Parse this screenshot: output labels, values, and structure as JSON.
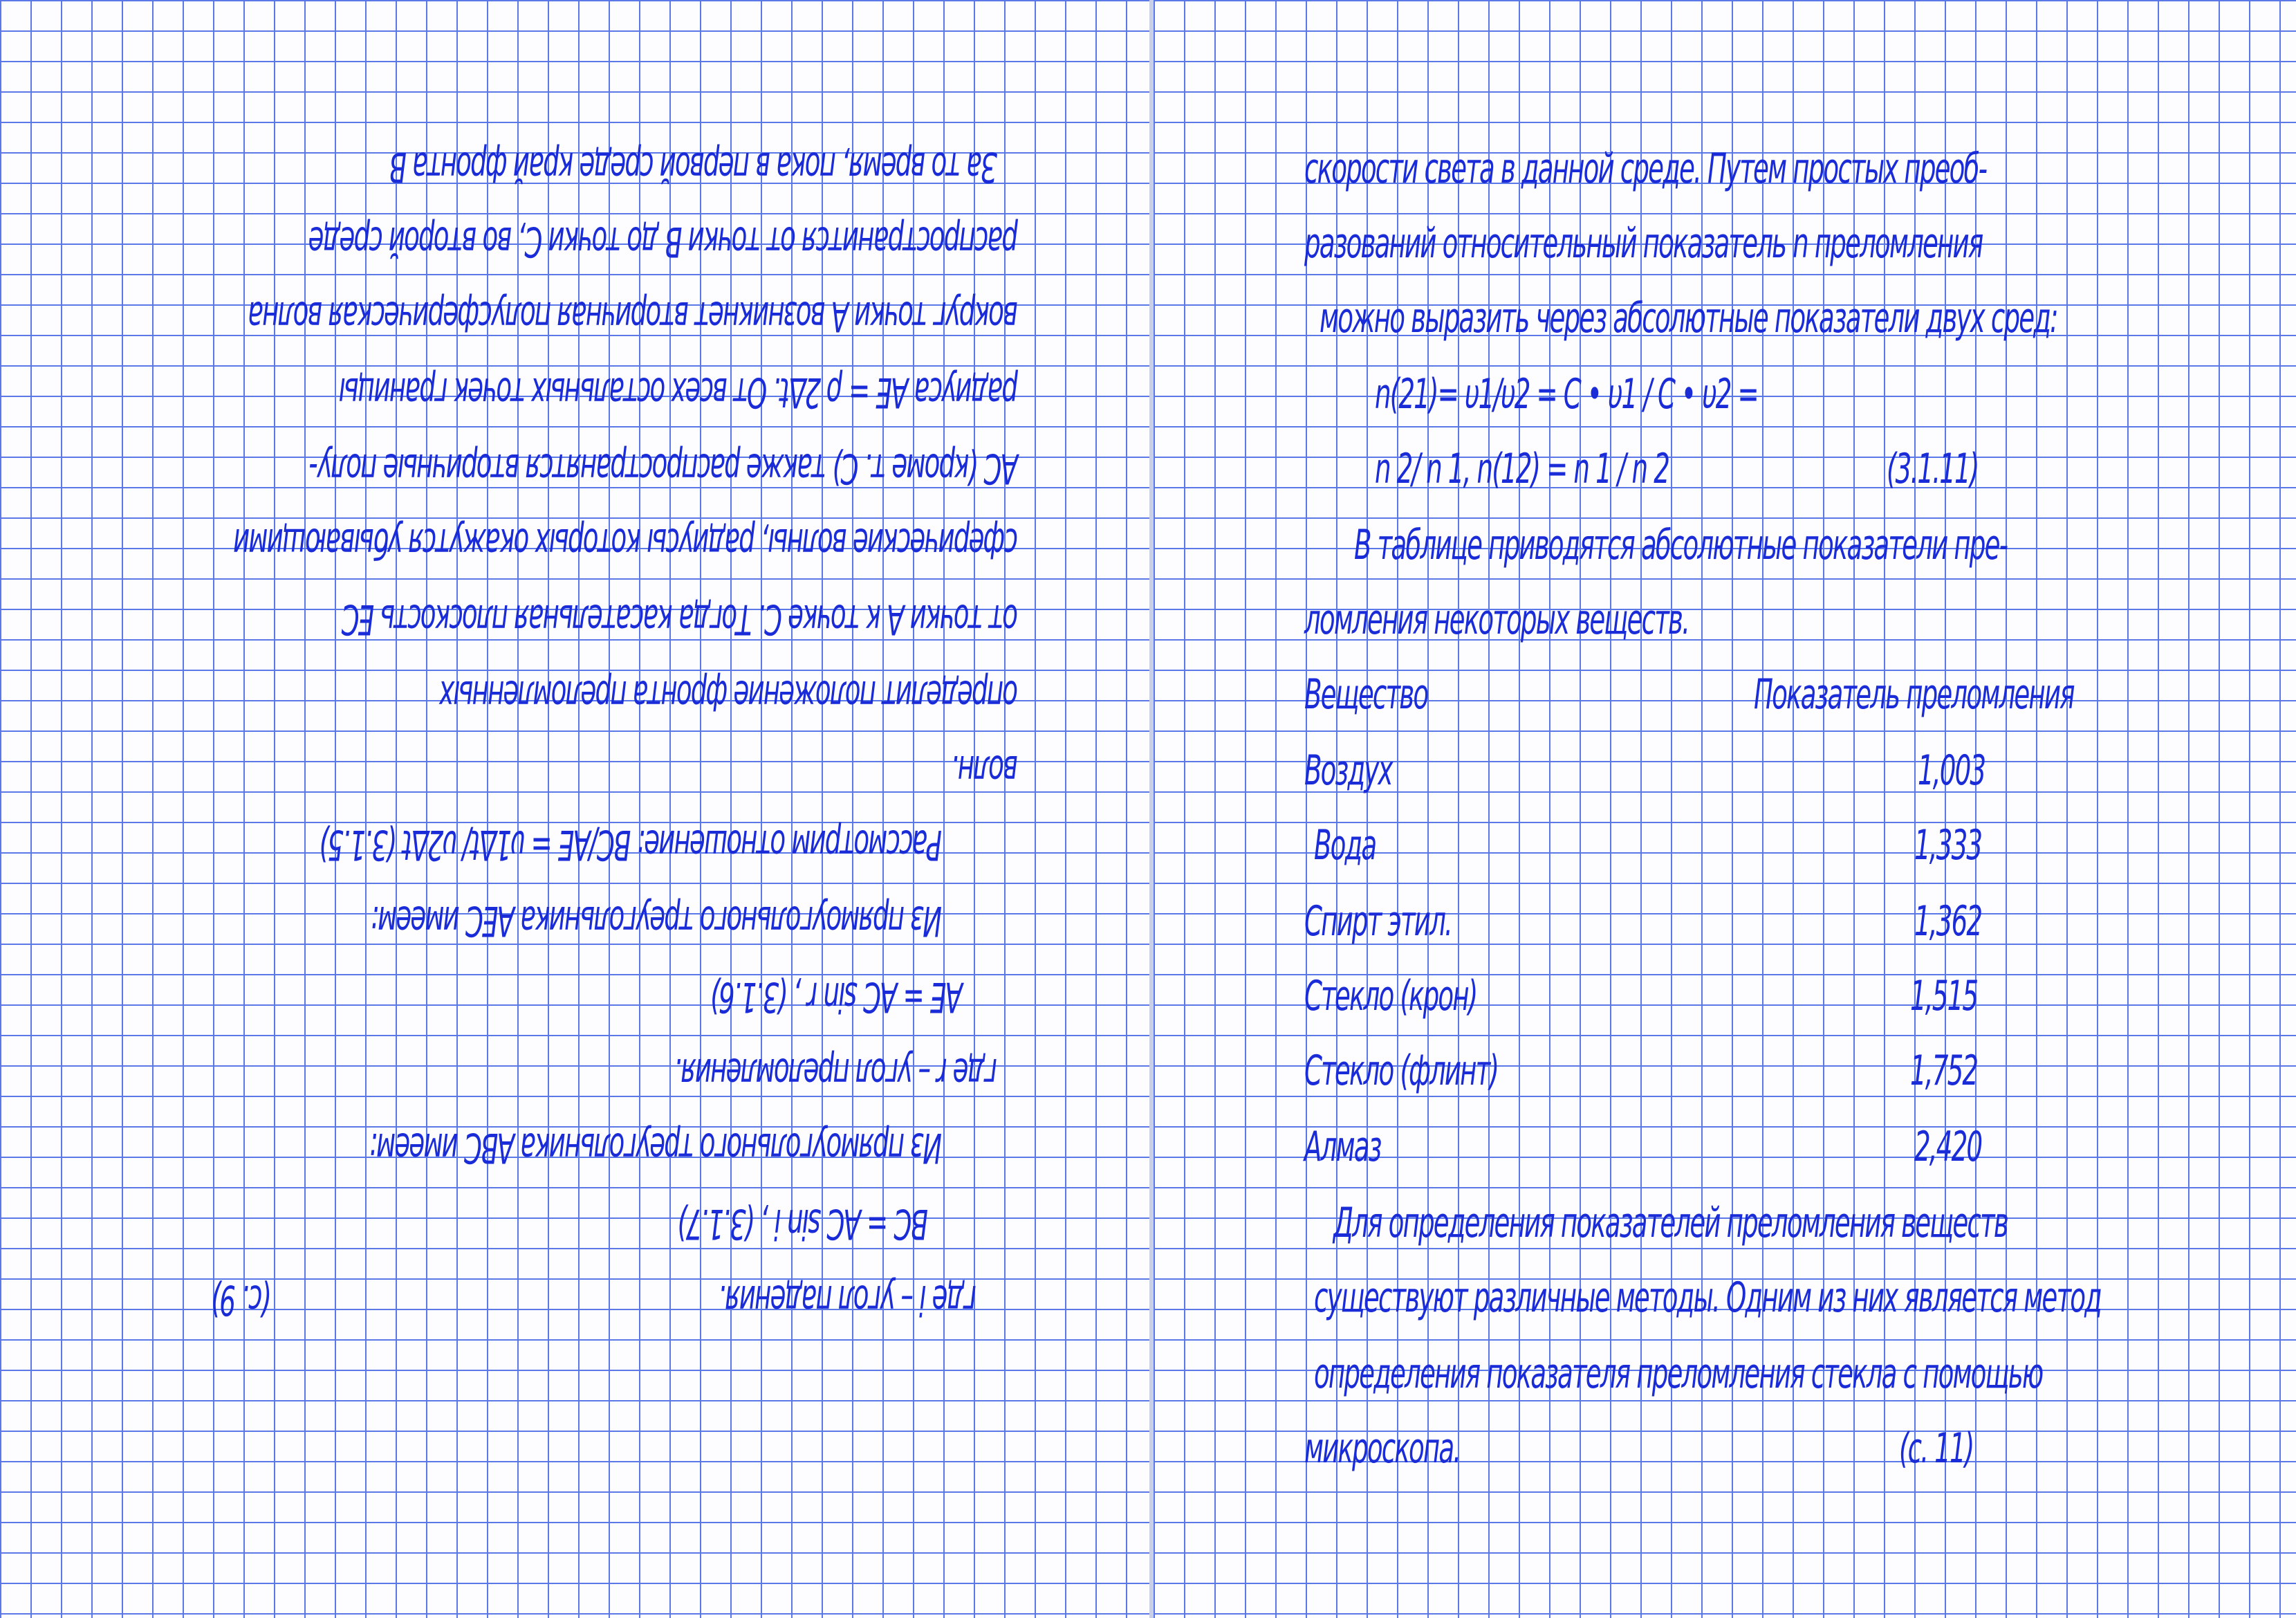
{
  "left_page": {
    "lines": [
      "За то время, пока в первой среде край фронта В",
      "распространится от точки В до точки С, во второй среде",
      "вокруг точки А возникнет вторичная полусферическая волна",
      "радиуса АЕ = ρ 2Δt. От всех остальных точек границы",
      "АС (кроме т. С) также распространятся вторичные полу-",
      "сферические волны, радиусы которых окажутся убывающими",
      "от точки А к точке С. Тогда касательная плоскость ЕС",
      "определит положение фронта преломленных",
      "волн.",
      "Рассмотрим отношение: ВС/АЕ = υ1Δt/ υ2Δt (3.1.5)",
      "Из прямоугольного треугольника АЕС имеем:",
      "АЕ = АС sin r , (3.1.6)",
      "где r – угол преломления.",
      "Из прямоугольного треугольника АВС имеем:",
      "ВС = АС sin i , (3.1.7)",
      "где i – угол падения.",
      "(с. 9)"
    ]
  },
  "right_page": {
    "lines": [
      "скорости света в данной среде. Путем простых преоб-",
      "разований относительный показатель n преломления",
      "можно выразить через абсолютные показатели двух сред:",
      "n(21)= υ1/υ2 = С • υ1 / С • υ2 =",
      "n 2/ n 1, n(12) = n 1 / n 2",
      "(3.1.11)",
      "В таблице приводятся абсолютные показатели пре-",
      "ломления некоторых веществ."
    ],
    "table": {
      "header_substance": "Вещество",
      "header_index": "Показатель преломления",
      "rows": [
        {
          "substance": "Воздух",
          "index": "1,003"
        },
        {
          "substance": "Вода",
          "index": "1,333"
        },
        {
          "substance": "Спирт этил.",
          "index": "1,362"
        },
        {
          "substance": "Стекло (крон)",
          "index": "1,515"
        },
        {
          "substance": "Стекло (флинт)",
          "index": "1,752"
        },
        {
          "substance": "Алмаз",
          "index": "2,420"
        }
      ]
    },
    "after_lines": [
      "Для определения показателей преломления веществ",
      "существуют различные методы. Одним из них является метод",
      "определения показателя преломления стекла с помощью",
      "микроскопа."
    ],
    "page_number": "(с. 11)"
  },
  "colors": {
    "ink": "#1a2bd8",
    "grid": "#5a78e8",
    "paper": "#fdfdff"
  }
}
